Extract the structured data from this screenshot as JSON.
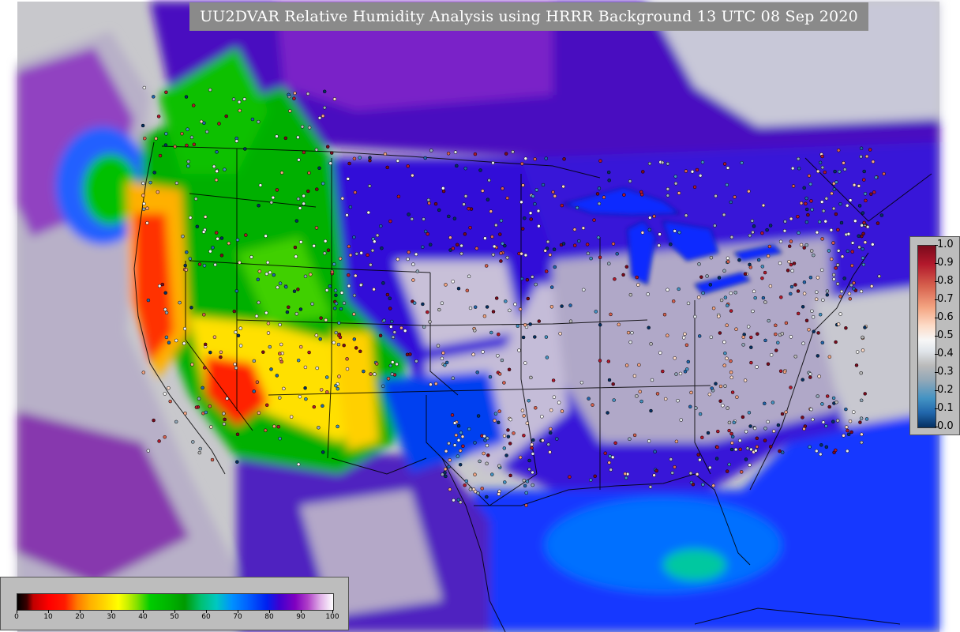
{
  "title": "UU2DVAR Relative Humidity Analysis using HRRR Background 13 UTC 08 Sep 2020",
  "colorbars": {
    "station_ratio": {
      "ticks": [
        "1.0",
        "0.9",
        "0.8",
        "0.7",
        "0.6",
        "0.5",
        "0.4",
        "0.3",
        "0.2",
        "0.1",
        "0.0"
      ],
      "colors": [
        "#7a0a1c",
        "#b2182b",
        "#d6604d",
        "#f4a582",
        "#fddbc7",
        "#f7f7f7",
        "#e0e5ea",
        "#bababa",
        "#92a8b8",
        "#4393c3",
        "#2166ac",
        "#053061"
      ]
    },
    "relative_humidity": {
      "ticks": [
        "0",
        "10",
        "20",
        "30",
        "40",
        "50",
        "60",
        "70",
        "80",
        "90",
        "100"
      ],
      "colors": [
        "#000000",
        "#ff0000",
        "#ff7a00",
        "#ffff00",
        "#00cc00",
        "#009a00",
        "#00c8c0",
        "#0060ff",
        "#8000c0",
        "#e0b0e8",
        "#ffffff"
      ]
    }
  },
  "map_colors": {
    "land_dry": "#ff2000",
    "land_mid": "#00b000",
    "land_moist": "#0040e0",
    "land_humid": "#7a00b0",
    "saturated": "#d0d0d0",
    "ocean": "#1030ff",
    "border": "#000000"
  }
}
